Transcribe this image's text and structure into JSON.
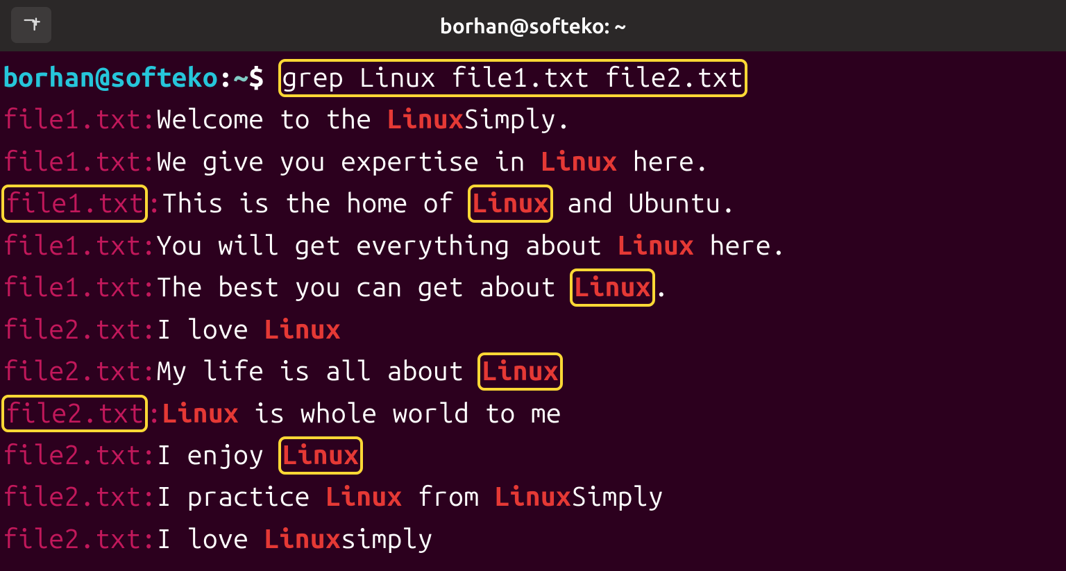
{
  "titlebar": {
    "title": "borhan@softeko: ~",
    "new_tab_icon": "new-tab"
  },
  "prompt": {
    "user": "borhan@softeko",
    "sep": ":",
    "path": "~",
    "dollar": "$ ",
    "command": "grep Linux file1.txt file2.txt"
  },
  "colors": {
    "bg": "#2c001e",
    "titlebar_bg": "#2b2828",
    "tab_bg": "#3d3a3a",
    "txt": "#ffffff",
    "user": "#26c6da",
    "path": "#80cbc4",
    "fname": "#c2185b",
    "match": "#e53935",
    "highlight_border": "#fdd835"
  },
  "output": [
    {
      "file": "file1.txt",
      "file_boxed": false,
      "segments": [
        {
          "t": "Welcome to the ",
          "k": "txt"
        },
        {
          "t": "Linux",
          "k": "match",
          "boxed": false
        },
        {
          "t": "Simply.",
          "k": "txt"
        }
      ]
    },
    {
      "file": "file1.txt",
      "file_boxed": false,
      "segments": [
        {
          "t": "We give you expertise in ",
          "k": "txt"
        },
        {
          "t": "Linux",
          "k": "match",
          "boxed": false
        },
        {
          "t": " here.",
          "k": "txt"
        }
      ]
    },
    {
      "file": "file1.txt",
      "file_boxed": true,
      "segments": [
        {
          "t": "This is the home of ",
          "k": "txt"
        },
        {
          "t": "Linux",
          "k": "match",
          "boxed": true
        },
        {
          "t": " and Ubuntu.",
          "k": "txt"
        }
      ]
    },
    {
      "file": "file1.txt",
      "file_boxed": false,
      "segments": [
        {
          "t": "You will get everything about ",
          "k": "txt"
        },
        {
          "t": "Linux",
          "k": "match",
          "boxed": false
        },
        {
          "t": " here.",
          "k": "txt"
        }
      ]
    },
    {
      "file": "file1.txt",
      "file_boxed": false,
      "segments": [
        {
          "t": "The best you can get about ",
          "k": "txt"
        },
        {
          "t": "Linux",
          "k": "match",
          "boxed": true
        },
        {
          "t": ".",
          "k": "txt"
        }
      ]
    },
    {
      "file": "file2.txt",
      "file_boxed": false,
      "segments": [
        {
          "t": "I love ",
          "k": "txt"
        },
        {
          "t": "Linux",
          "k": "match",
          "boxed": false
        }
      ]
    },
    {
      "file": "file2.txt",
      "file_boxed": false,
      "segments": [
        {
          "t": "My life is all about ",
          "k": "txt"
        },
        {
          "t": "Linux",
          "k": "match",
          "boxed": true
        }
      ]
    },
    {
      "file": "file2.txt",
      "file_boxed": true,
      "segments": [
        {
          "t": "Linux",
          "k": "match",
          "boxed": false
        },
        {
          "t": " is whole world to me",
          "k": "txt"
        }
      ]
    },
    {
      "file": "file2.txt",
      "file_boxed": false,
      "segments": [
        {
          "t": "I enjoy ",
          "k": "txt"
        },
        {
          "t": "Linux",
          "k": "match",
          "boxed": true
        }
      ]
    },
    {
      "file": "file2.txt",
      "file_boxed": false,
      "segments": [
        {
          "t": "I practice ",
          "k": "txt"
        },
        {
          "t": "Linux",
          "k": "match",
          "boxed": false
        },
        {
          "t": " from ",
          "k": "txt"
        },
        {
          "t": "Linux",
          "k": "match",
          "boxed": false
        },
        {
          "t": "Simply",
          "k": "txt"
        }
      ]
    },
    {
      "file": "file2.txt",
      "file_boxed": false,
      "segments": [
        {
          "t": "I love ",
          "k": "txt"
        },
        {
          "t": "Linux",
          "k": "match",
          "boxed": false
        },
        {
          "t": "simply",
          "k": "txt"
        }
      ]
    }
  ]
}
